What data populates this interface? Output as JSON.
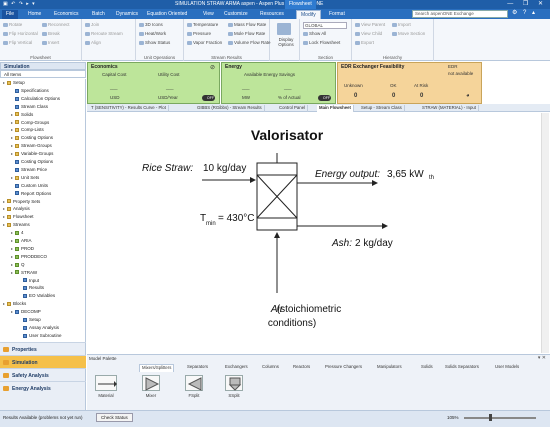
{
  "titlebar": {
    "title": "SIMULATION STRAW ARMA aspen - Aspen Plus V10 - aspenONE",
    "context": "Flowsheet",
    "quick_access": "▣ ↶ ↷ ▸ ▾",
    "window_controls": "— ❐ ✕"
  },
  "ribbon_tabs": [
    "File",
    "Home",
    "Economics",
    "Batch",
    "Dynamics",
    "Equation Oriented",
    "View",
    "Customize",
    "Resources",
    "Modify",
    "Format"
  ],
  "search_placeholder": "Search aspenONE Exchange",
  "ribbon": {
    "flowsheet": {
      "items": [
        "Rotate",
        "Flip Horizontal",
        "Flip Vertical",
        "Reconnect",
        "Break",
        "Insert",
        "Join",
        "Reroute Stream",
        "Align"
      ],
      "label": "Flowsheet"
    },
    "unit_ops": {
      "items": [
        "3D Icons",
        "Heat/Work",
        "Show Status"
      ],
      "label": "Unit Operations"
    },
    "stream_results": {
      "items": [
        "Temperature",
        "Pressure",
        "Vapor Fraction",
        "Mass Flow Rate",
        "Mole Flow Rate",
        "Volume Flow Rate"
      ],
      "label": "Stream Results"
    },
    "display": {
      "label": "Display Options"
    },
    "section": {
      "items": [
        "GLOBAL",
        "Show All",
        "Lock Flowsheet"
      ],
      "label": "Section"
    },
    "hierarchy": {
      "items": [
        "View Parent",
        "View Child",
        "Export",
        "Import",
        "Move Section"
      ],
      "label": "Hierarchy"
    }
  },
  "nav": {
    "header": "Simulation",
    "filter": "All Items",
    "tree": [
      {
        "label": "Setup",
        "level": 0,
        "icon": "folder"
      },
      {
        "label": "Specifications",
        "level": 1,
        "icon": "form"
      },
      {
        "label": "Calculation Options",
        "level": 1,
        "icon": "form"
      },
      {
        "label": "Stream Class",
        "level": 1,
        "icon": "form"
      },
      {
        "label": "Solids",
        "level": 1,
        "icon": "folder"
      },
      {
        "label": "Comp-Groups",
        "level": 1,
        "icon": "folder"
      },
      {
        "label": "Comp-Lists",
        "level": 1,
        "icon": "folder"
      },
      {
        "label": "Costing Options",
        "level": 1,
        "icon": "folder"
      },
      {
        "label": "Stream-Groups",
        "level": 1,
        "icon": "folder"
      },
      {
        "label": "Variable-Groups",
        "level": 1,
        "icon": "folder"
      },
      {
        "label": "Costing Options",
        "level": 1,
        "icon": "form"
      },
      {
        "label": "Stream Price",
        "level": 1,
        "icon": "form"
      },
      {
        "label": "Unit Sets",
        "level": 1,
        "icon": "folder"
      },
      {
        "label": "Custom Units",
        "level": 1,
        "icon": "form"
      },
      {
        "label": "Report Options",
        "level": 1,
        "icon": "form"
      },
      {
        "label": "Property Sets",
        "level": 0,
        "icon": "folder"
      },
      {
        "label": "Analysis",
        "level": 0,
        "icon": "folder"
      },
      {
        "label": "Flowsheet",
        "level": 0,
        "icon": "folder"
      },
      {
        "label": "Streams",
        "level": 0,
        "icon": "folder"
      },
      {
        "label": "4",
        "level": 1,
        "icon": "stream"
      },
      {
        "label": "ARIA",
        "level": 1,
        "icon": "stream"
      },
      {
        "label": "PROD",
        "level": 1,
        "icon": "stream"
      },
      {
        "label": "PRODDECO",
        "level": 1,
        "icon": "stream"
      },
      {
        "label": "Q",
        "level": 1,
        "icon": "stream"
      },
      {
        "label": "STRAW",
        "level": 1,
        "icon": "stream"
      },
      {
        "label": "Input",
        "level": 2,
        "icon": "form"
      },
      {
        "label": "Results",
        "level": 2,
        "icon": "form"
      },
      {
        "label": "EO Variables",
        "level": 2,
        "icon": "form"
      },
      {
        "label": "Blocks",
        "level": 0,
        "icon": "folder"
      },
      {
        "label": "DECOMP",
        "level": 1,
        "icon": "block"
      },
      {
        "label": "Setup",
        "level": 2,
        "icon": "form"
      },
      {
        "label": "Assay Analysis",
        "level": 2,
        "icon": "form"
      },
      {
        "label": "User Subroutine",
        "level": 2,
        "icon": "form"
      }
    ]
  },
  "left_buttons": [
    "Properties",
    "Simulation",
    "Safety Analysis",
    "Energy Analysis"
  ],
  "economics": {
    "title": "Economics",
    "capital_label": "Capital Cost",
    "utility_label": "Utility Cost",
    "capital_value": "___",
    "utility_value": "___",
    "capital_unit": "USD",
    "utility_unit": "USD/Year",
    "toggle": "OFF"
  },
  "energy": {
    "title": "Energy",
    "savings_label": "Available Energy Savings",
    "value1": "___",
    "value2": "___",
    "unit1": "MW",
    "unit2": "% of Actual",
    "toggle": "OFF"
  },
  "edr": {
    "title": "EDR Exchanger Feasibility",
    "col_unknown": "Unknown",
    "col_ok": "OK",
    "col_risk": "At Risk",
    "v_unknown": "0",
    "v_ok": "0",
    "v_risk": "0",
    "edr_label": "EDR",
    "edr_status": "not available"
  },
  "doc_tabs": [
    "T (SENSITIVITY) - Results Curve - Plot",
    "GIBBS (RGibbs) - Stream Results",
    "Control Panel",
    "Main Flowsheet",
    "Setup - Stream Class",
    "STRAW (MATERIAL) - Input"
  ],
  "active_doc_tab": "Main Flowsheet",
  "diagram": {
    "title": "Valorisator",
    "feed_label": "Rice Straw:",
    "feed_value": "10 kg/day",
    "energy_label": "Energy output:",
    "energy_value": "3,65 kW",
    "energy_sub": "th",
    "tmin_symbol": "T",
    "tmin_sub": "min",
    "tmin_value": "= 430°C",
    "ash_label": "Ash:",
    "ash_value": "2 kg/day",
    "air_label": "Air",
    "air_note1": "(stoichiometric",
    "air_note2": "conditions)"
  },
  "palette": {
    "title": "Model Palette",
    "tabs": [
      "Mixers/Splitters",
      "Separators",
      "Exchangers",
      "Columns",
      "Reactors",
      "Pressure Changers",
      "Manipulators",
      "Solids",
      "Solids Separators",
      "User Models"
    ],
    "models": [
      "Material",
      "Mixer",
      "FSplit",
      "SSplit"
    ]
  },
  "status": {
    "message": "Results Available (problems not yet run)",
    "check_button": "Check Status",
    "zoom": "105%"
  },
  "colors": {
    "economics_bg": "#bde59a",
    "energy_bg": "#bde59a",
    "edr_bg": "#f5d49a",
    "brand_blue": "#1f5ea8"
  }
}
